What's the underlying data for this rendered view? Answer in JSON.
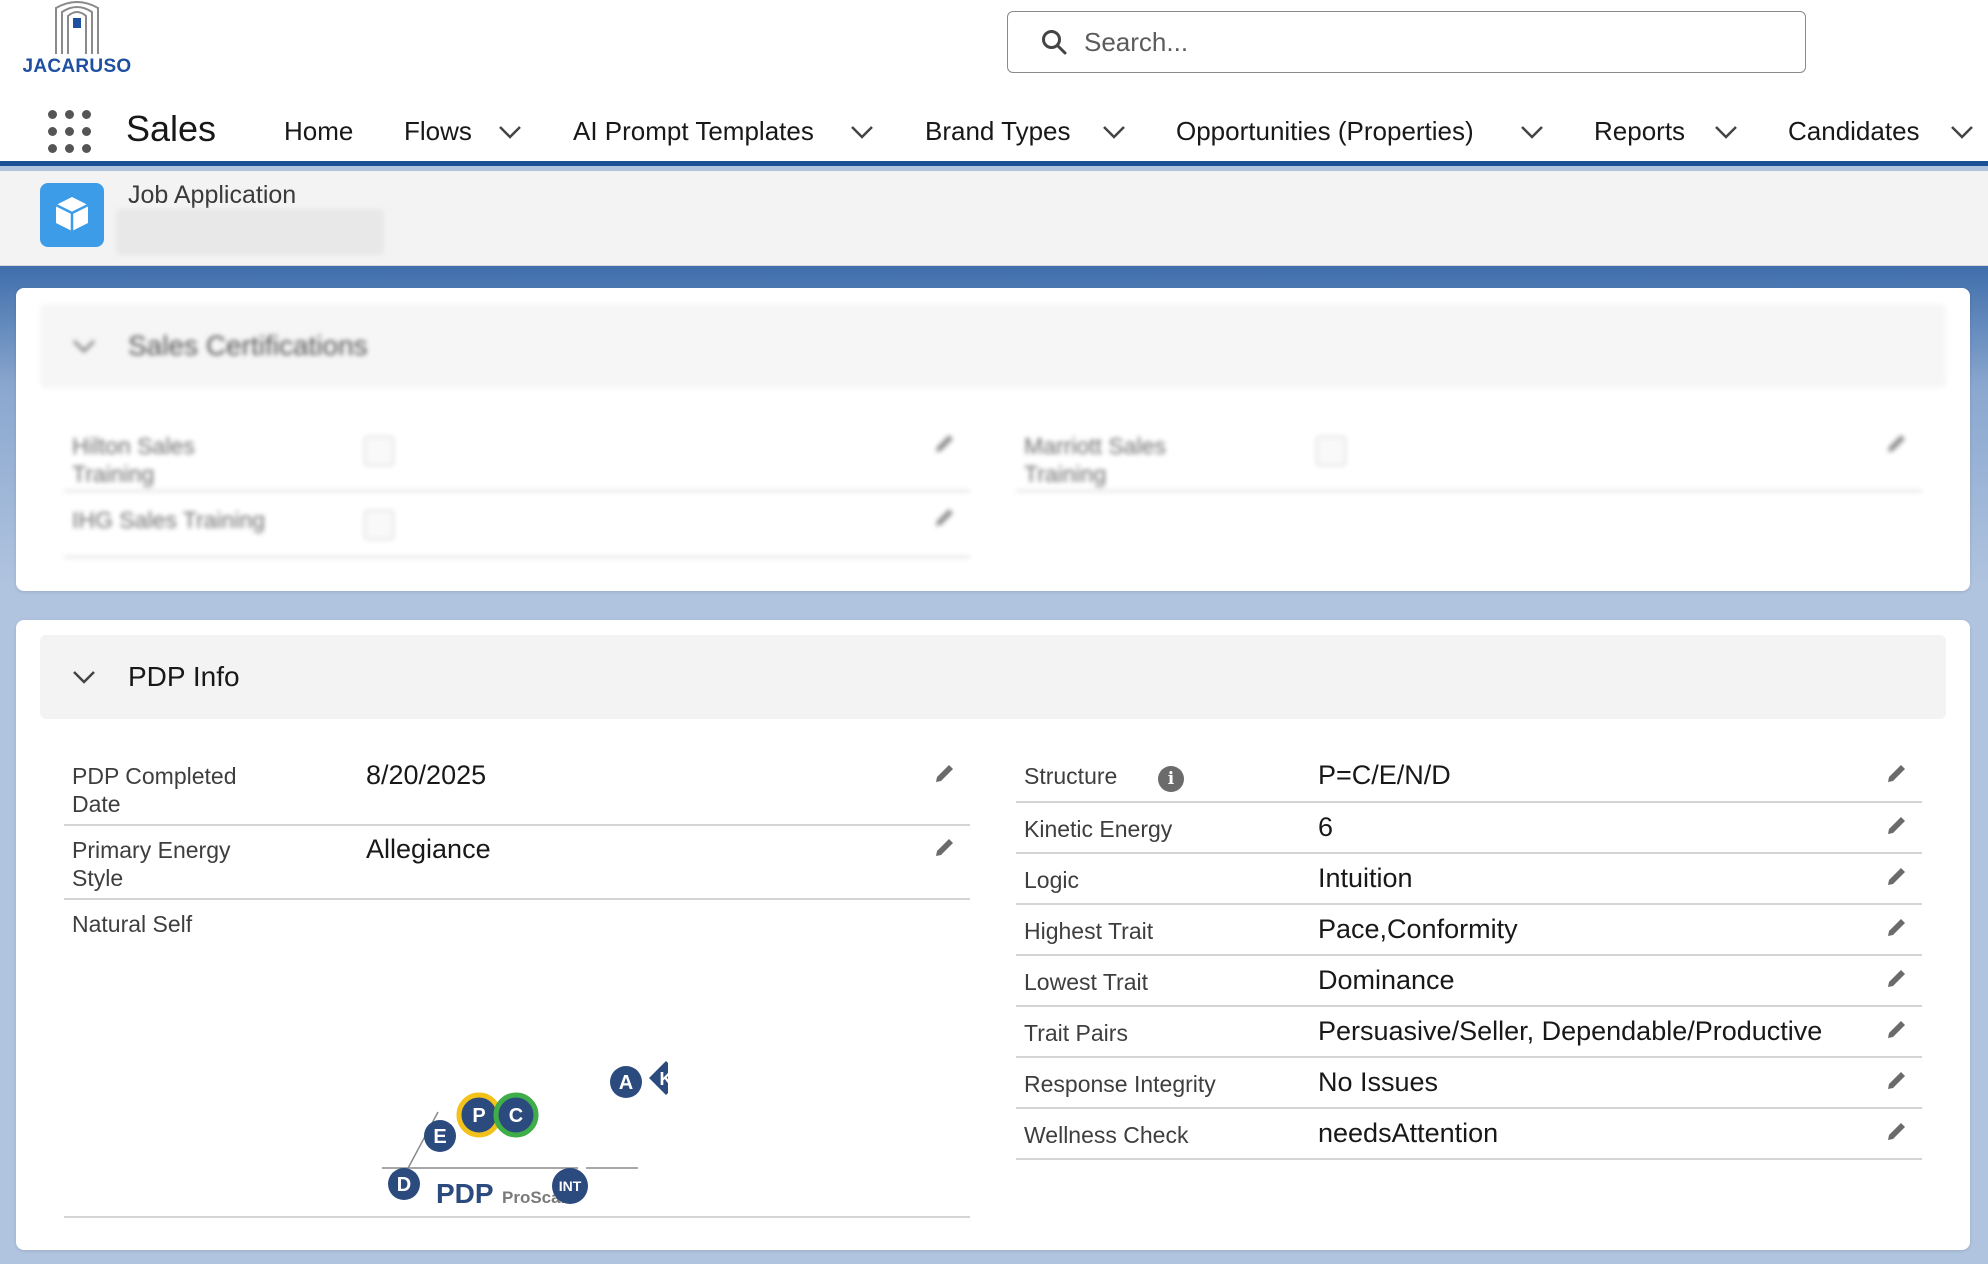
{
  "header": {
    "logo_text": "JACARUSO",
    "search_placeholder": "Search..."
  },
  "nav": {
    "app_name": "Sales",
    "items": [
      {
        "label": "Home"
      },
      {
        "label": "Flows"
      },
      {
        "label": "AI Prompt Templates"
      },
      {
        "label": "Brand Types"
      },
      {
        "label": "Opportunities (Properties)"
      },
      {
        "label": "Reports"
      },
      {
        "label": "Candidates"
      }
    ]
  },
  "record": {
    "object_type": "Job Application"
  },
  "sales_certifications": {
    "title": "Sales Certifications",
    "fields": [
      {
        "label": "Hilton Sales Training"
      },
      {
        "label": "Marriott Sales Training"
      },
      {
        "label": "IHG Sales Training"
      }
    ]
  },
  "pdp_info": {
    "title": "PDP Info",
    "left_fields": [
      {
        "label": "PDP Completed Date",
        "value": "8/20/2025"
      },
      {
        "label": "Primary Energy Style",
        "value": "Allegiance"
      },
      {
        "label": "Natural Self",
        "value": ""
      }
    ],
    "right_fields": [
      {
        "label": "Structure",
        "value": "P=C/E/N/D"
      },
      {
        "label": "Kinetic Energy",
        "value": "6"
      },
      {
        "label": "Logic",
        "value": "Intuition"
      },
      {
        "label": "Highest Trait",
        "value": "Pace,Conformity"
      },
      {
        "label": "Lowest Trait",
        "value": "Dominance"
      },
      {
        "label": "Trait Pairs",
        "value": "Persuasive/Seller, Dependable/Productive"
      },
      {
        "label": "Response Integrity",
        "value": "No Issues"
      },
      {
        "label": "Wellness Check",
        "value": "needsAttention"
      }
    ],
    "graph": {
      "markers": [
        "A",
        "K",
        "P",
        "C",
        "E",
        "D"
      ],
      "brand": "PDP",
      "brand_sub": "ProScan",
      "badge": "INT"
    }
  },
  "colors": {
    "nav_border": "#1b5297",
    "record_icon": "#3d9ce8",
    "marker_navy": "#2b4a7e",
    "ring_yellow": "#f2c21b",
    "ring_green": "#3fae49"
  }
}
